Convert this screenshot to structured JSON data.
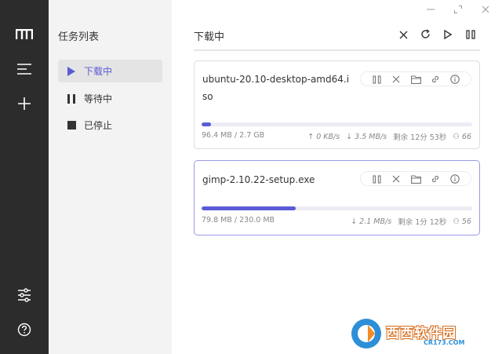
{
  "rail": {
    "items": [
      "logo-icon",
      "menu-icon",
      "add-icon",
      "settings-sliders-icon",
      "help-icon"
    ]
  },
  "sidebar": {
    "title": "任务列表",
    "items": [
      {
        "label": "下载中",
        "icon": "play-icon",
        "active": true
      },
      {
        "label": "等待中",
        "icon": "pause-icon",
        "active": false
      },
      {
        "label": "已停止",
        "icon": "stop-icon",
        "active": false
      }
    ]
  },
  "window_controls": [
    "minimize-icon",
    "maximize-icon",
    "close-icon"
  ],
  "main": {
    "title": "下载中",
    "toolbar": [
      "close-icon",
      "refresh-icon",
      "play-icon",
      "pause-icon"
    ]
  },
  "tasks": [
    {
      "name": "ubuntu-20.10-desktop-amd64.iso",
      "progress_fraction": 0.035,
      "size_text": "96.4 MB / 2.7 GB",
      "upload_speed": "0 KB/s",
      "download_speed": "3.5 MB/s",
      "remaining": "剩余 12分 53秒",
      "connections": "66",
      "tools": [
        "pause-icon",
        "close-icon",
        "folder-icon",
        "link-icon",
        "info-icon"
      ]
    },
    {
      "name": "gimp-2.10.22-setup.exe",
      "progress_fraction": 0.347,
      "size_text": "79.8 MB / 230.0 MB",
      "download_speed": "2.1 MB/s",
      "remaining": "剩余 1分 12秒",
      "connections": "56",
      "tools": [
        "pause-icon",
        "close-icon",
        "folder-icon",
        "link-icon",
        "info-icon"
      ]
    }
  ],
  "watermark": {
    "title": "西西软件园",
    "sub": "CR173.COM"
  },
  "colors": {
    "accent": "#5b5bd6",
    "rail_bg": "#2c2c2c",
    "sidebar_bg": "#f3f3f3",
    "card_active_border": "#9a9ae6"
  }
}
